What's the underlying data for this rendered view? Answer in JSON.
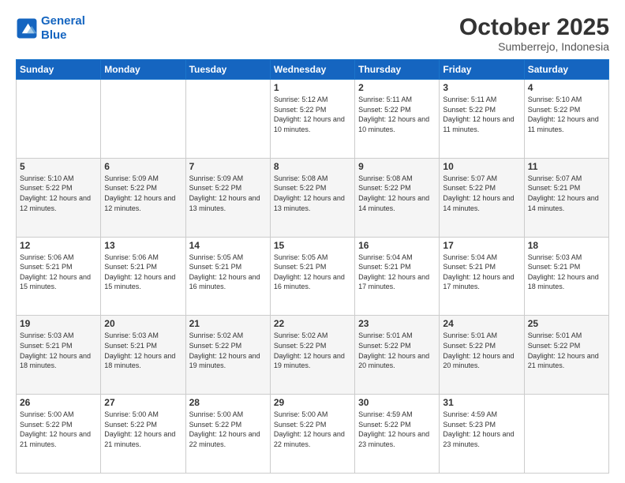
{
  "logo": {
    "line1": "General",
    "line2": "Blue"
  },
  "title": "October 2025",
  "subtitle": "Sumberrejo, Indonesia",
  "weekdays": [
    "Sunday",
    "Monday",
    "Tuesday",
    "Wednesday",
    "Thursday",
    "Friday",
    "Saturday"
  ],
  "weeks": [
    [
      {
        "day": "",
        "sunrise": "",
        "sunset": "",
        "daylight": ""
      },
      {
        "day": "",
        "sunrise": "",
        "sunset": "",
        "daylight": ""
      },
      {
        "day": "",
        "sunrise": "",
        "sunset": "",
        "daylight": ""
      },
      {
        "day": "1",
        "sunrise": "Sunrise: 5:12 AM",
        "sunset": "Sunset: 5:22 PM",
        "daylight": "Daylight: 12 hours and 10 minutes."
      },
      {
        "day": "2",
        "sunrise": "Sunrise: 5:11 AM",
        "sunset": "Sunset: 5:22 PM",
        "daylight": "Daylight: 12 hours and 10 minutes."
      },
      {
        "day": "3",
        "sunrise": "Sunrise: 5:11 AM",
        "sunset": "Sunset: 5:22 PM",
        "daylight": "Daylight: 12 hours and 11 minutes."
      },
      {
        "day": "4",
        "sunrise": "Sunrise: 5:10 AM",
        "sunset": "Sunset: 5:22 PM",
        "daylight": "Daylight: 12 hours and 11 minutes."
      }
    ],
    [
      {
        "day": "5",
        "sunrise": "Sunrise: 5:10 AM",
        "sunset": "Sunset: 5:22 PM",
        "daylight": "Daylight: 12 hours and 12 minutes."
      },
      {
        "day": "6",
        "sunrise": "Sunrise: 5:09 AM",
        "sunset": "Sunset: 5:22 PM",
        "daylight": "Daylight: 12 hours and 12 minutes."
      },
      {
        "day": "7",
        "sunrise": "Sunrise: 5:09 AM",
        "sunset": "Sunset: 5:22 PM",
        "daylight": "Daylight: 12 hours and 13 minutes."
      },
      {
        "day": "8",
        "sunrise": "Sunrise: 5:08 AM",
        "sunset": "Sunset: 5:22 PM",
        "daylight": "Daylight: 12 hours and 13 minutes."
      },
      {
        "day": "9",
        "sunrise": "Sunrise: 5:08 AM",
        "sunset": "Sunset: 5:22 PM",
        "daylight": "Daylight: 12 hours and 14 minutes."
      },
      {
        "day": "10",
        "sunrise": "Sunrise: 5:07 AM",
        "sunset": "Sunset: 5:22 PM",
        "daylight": "Daylight: 12 hours and 14 minutes."
      },
      {
        "day": "11",
        "sunrise": "Sunrise: 5:07 AM",
        "sunset": "Sunset: 5:21 PM",
        "daylight": "Daylight: 12 hours and 14 minutes."
      }
    ],
    [
      {
        "day": "12",
        "sunrise": "Sunrise: 5:06 AM",
        "sunset": "Sunset: 5:21 PM",
        "daylight": "Daylight: 12 hours and 15 minutes."
      },
      {
        "day": "13",
        "sunrise": "Sunrise: 5:06 AM",
        "sunset": "Sunset: 5:21 PM",
        "daylight": "Daylight: 12 hours and 15 minutes."
      },
      {
        "day": "14",
        "sunrise": "Sunrise: 5:05 AM",
        "sunset": "Sunset: 5:21 PM",
        "daylight": "Daylight: 12 hours and 16 minutes."
      },
      {
        "day": "15",
        "sunrise": "Sunrise: 5:05 AM",
        "sunset": "Sunset: 5:21 PM",
        "daylight": "Daylight: 12 hours and 16 minutes."
      },
      {
        "day": "16",
        "sunrise": "Sunrise: 5:04 AM",
        "sunset": "Sunset: 5:21 PM",
        "daylight": "Daylight: 12 hours and 17 minutes."
      },
      {
        "day": "17",
        "sunrise": "Sunrise: 5:04 AM",
        "sunset": "Sunset: 5:21 PM",
        "daylight": "Daylight: 12 hours and 17 minutes."
      },
      {
        "day": "18",
        "sunrise": "Sunrise: 5:03 AM",
        "sunset": "Sunset: 5:21 PM",
        "daylight": "Daylight: 12 hours and 18 minutes."
      }
    ],
    [
      {
        "day": "19",
        "sunrise": "Sunrise: 5:03 AM",
        "sunset": "Sunset: 5:21 PM",
        "daylight": "Daylight: 12 hours and 18 minutes."
      },
      {
        "day": "20",
        "sunrise": "Sunrise: 5:03 AM",
        "sunset": "Sunset: 5:21 PM",
        "daylight": "Daylight: 12 hours and 18 minutes."
      },
      {
        "day": "21",
        "sunrise": "Sunrise: 5:02 AM",
        "sunset": "Sunset: 5:22 PM",
        "daylight": "Daylight: 12 hours and 19 minutes."
      },
      {
        "day": "22",
        "sunrise": "Sunrise: 5:02 AM",
        "sunset": "Sunset: 5:22 PM",
        "daylight": "Daylight: 12 hours and 19 minutes."
      },
      {
        "day": "23",
        "sunrise": "Sunrise: 5:01 AM",
        "sunset": "Sunset: 5:22 PM",
        "daylight": "Daylight: 12 hours and 20 minutes."
      },
      {
        "day": "24",
        "sunrise": "Sunrise: 5:01 AM",
        "sunset": "Sunset: 5:22 PM",
        "daylight": "Daylight: 12 hours and 20 minutes."
      },
      {
        "day": "25",
        "sunrise": "Sunrise: 5:01 AM",
        "sunset": "Sunset: 5:22 PM",
        "daylight": "Daylight: 12 hours and 21 minutes."
      }
    ],
    [
      {
        "day": "26",
        "sunrise": "Sunrise: 5:00 AM",
        "sunset": "Sunset: 5:22 PM",
        "daylight": "Daylight: 12 hours and 21 minutes."
      },
      {
        "day": "27",
        "sunrise": "Sunrise: 5:00 AM",
        "sunset": "Sunset: 5:22 PM",
        "daylight": "Daylight: 12 hours and 21 minutes."
      },
      {
        "day": "28",
        "sunrise": "Sunrise: 5:00 AM",
        "sunset": "Sunset: 5:22 PM",
        "daylight": "Daylight: 12 hours and 22 minutes."
      },
      {
        "day": "29",
        "sunrise": "Sunrise: 5:00 AM",
        "sunset": "Sunset: 5:22 PM",
        "daylight": "Daylight: 12 hours and 22 minutes."
      },
      {
        "day": "30",
        "sunrise": "Sunrise: 4:59 AM",
        "sunset": "Sunset: 5:22 PM",
        "daylight": "Daylight: 12 hours and 23 minutes."
      },
      {
        "day": "31",
        "sunrise": "Sunrise: 4:59 AM",
        "sunset": "Sunset: 5:23 PM",
        "daylight": "Daylight: 12 hours and 23 minutes."
      },
      {
        "day": "",
        "sunrise": "",
        "sunset": "",
        "daylight": ""
      }
    ]
  ]
}
